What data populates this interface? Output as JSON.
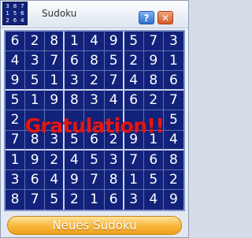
{
  "window": {
    "title": "Sudoku",
    "help_label": "?",
    "close_label": "✕"
  },
  "app_icon": [
    "3",
    "8",
    "7",
    "1",
    "5",
    "6",
    "2",
    "6",
    "4"
  ],
  "board": {
    "rows": [
      [
        "6",
        "2",
        "8",
        "1",
        "4",
        "9",
        "5",
        "7",
        "3"
      ],
      [
        "4",
        "3",
        "7",
        "6",
        "8",
        "5",
        "2",
        "9",
        "1"
      ],
      [
        "9",
        "5",
        "1",
        "3",
        "2",
        "7",
        "4",
        "8",
        "6"
      ],
      [
        "5",
        "1",
        "9",
        "8",
        "3",
        "4",
        "6",
        "2",
        "7"
      ],
      [
        "2",
        "",
        "",
        "",
        "",
        "",
        "",
        "",
        "5"
      ],
      [
        "7",
        "8",
        "3",
        "5",
        "6",
        "2",
        "9",
        "1",
        "4"
      ],
      [
        "1",
        "9",
        "2",
        "4",
        "5",
        "3",
        "7",
        "6",
        "8"
      ],
      [
        "3",
        "6",
        "4",
        "9",
        "7",
        "8",
        "1",
        "5",
        "2"
      ],
      [
        "8",
        "7",
        "5",
        "2",
        "1",
        "6",
        "3",
        "4",
        "9"
      ]
    ],
    "message": "Gratulation!!"
  },
  "footer": {
    "new_game_label": "Neues Sudoku"
  },
  "colors": {
    "board_bg": "#12227a",
    "digit": "#ffffff",
    "message": "#e41616",
    "button": "#f7b63a"
  }
}
